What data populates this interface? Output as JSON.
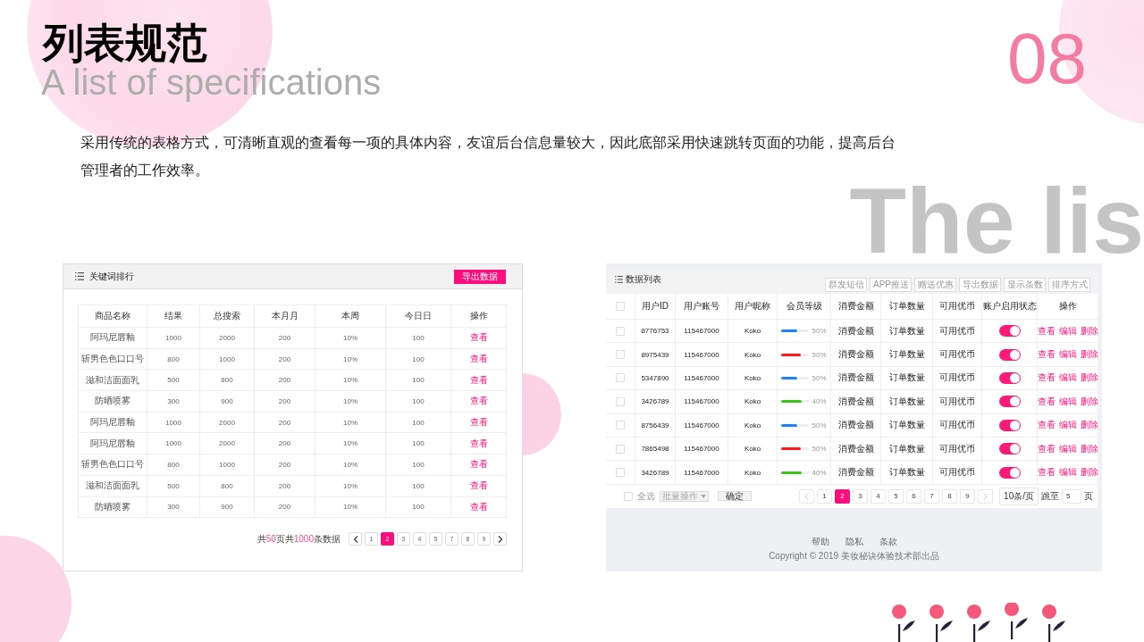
{
  "slide": {
    "title": "列表规范",
    "subtitle": "A list of specifications",
    "number": "08",
    "description": "采用传统的表格方式，可清晰直观的查看每一项的具体内容，友谊后台信息量较大，因此底部采用快速跳转页面的功能，提高后台管理者的工作效率。",
    "backdrop_text": "The lis"
  },
  "keyword_panel": {
    "title": "关键词排行",
    "export_button": "导出数据",
    "columns": [
      "商品名称",
      "结果",
      "总搜索",
      "本月月",
      "本周",
      "今日日",
      "操作"
    ],
    "rows": [
      {
        "cells": [
          "阿玛尼唇釉",
          "1000",
          "2000",
          "200",
          "10%",
          "100"
        ],
        "action": "查看"
      },
      {
        "cells": [
          "斩男色色口口号",
          "800",
          "1000",
          "200",
          "10%",
          "100"
        ],
        "action": "查看"
      },
      {
        "cells": [
          "滋和洁面面乳",
          "500",
          "800",
          "200",
          "10%",
          "100"
        ],
        "action": "查看"
      },
      {
        "cells": [
          "防晒喷雾",
          "300",
          "900",
          "200",
          "10%",
          "100"
        ],
        "action": "查看"
      },
      {
        "cells": [
          "阿玛尼唇釉",
          "1000",
          "2000",
          "200",
          "10%",
          "100"
        ],
        "action": "查看"
      },
      {
        "cells": [
          "阿玛尼唇釉",
          "1000",
          "2000",
          "200",
          "10%",
          "100"
        ],
        "action": "查看"
      },
      {
        "cells": [
          "斩男色色口口号",
          "800",
          "1000",
          "200",
          "10%",
          "100"
        ],
        "action": "查看"
      },
      {
        "cells": [
          "滋和洁面面乳",
          "500",
          "800",
          "200",
          "10%",
          "100"
        ],
        "action": "查看"
      },
      {
        "cells": [
          "防晒喷雾",
          "300",
          "900",
          "200",
          "10%",
          "100"
        ],
        "action": "查看"
      }
    ],
    "summary": [
      {
        "text": "共",
        "highlight": false
      },
      {
        "text": "50",
        "highlight": true
      },
      {
        "text": "页共",
        "highlight": false
      },
      {
        "text": "1000",
        "highlight": true
      },
      {
        "text": "条数据",
        "highlight": false
      }
    ],
    "pages": [
      {
        "label": "1",
        "selected": false
      },
      {
        "label": "2",
        "selected": true
      },
      {
        "label": "3",
        "selected": false
      },
      {
        "label": "4",
        "selected": false
      },
      {
        "label": "5",
        "selected": false
      },
      {
        "label": "7",
        "selected": false
      },
      {
        "label": "8",
        "selected": false
      },
      {
        "label": "9",
        "selected": false
      }
    ]
  },
  "user_panel": {
    "title": "数据列表",
    "dropdowns": [
      "群发短信",
      "APP推送",
      "赠送优惠",
      "导出数据",
      "显示条数",
      "排序方式"
    ],
    "header_checkbox": {
      "checked": false
    },
    "columns": [
      "用户ID",
      "用户账号",
      "用户昵称",
      "会员等级",
      "消费金额",
      "订单数量",
      "可用优币",
      "账户启用状态",
      "操作"
    ],
    "rows": [
      {
        "checked": false,
        "id": "8776753",
        "account": "115467000",
        "nickname": "Koko",
        "level": 0.55,
        "color": "#1a82ff",
        "percent": "50%",
        "amount": "消费金额",
        "orders": "订单数量",
        "coins": "可用优币",
        "on": true,
        "actions": [
          "查看",
          "编辑",
          "删除"
        ]
      },
      {
        "checked": false,
        "id": "8975439",
        "account": "115467000",
        "nickname": "Koko",
        "level": 0.68,
        "color": "#ff1a1a",
        "percent": "50%",
        "amount": "消费金额",
        "orders": "订单数量",
        "coins": "可用优币",
        "on": true,
        "actions": [
          "查看",
          "编辑",
          "删除"
        ]
      },
      {
        "checked": false,
        "id": "5347890",
        "account": "115467000",
        "nickname": "Koko",
        "level": 0.55,
        "color": "#1a82ff",
        "percent": "50%",
        "amount": "消费金额",
        "orders": "订单数量",
        "coins": "可用优币",
        "on": true,
        "actions": [
          "查看",
          "编辑",
          "删除"
        ]
      },
      {
        "checked": false,
        "id": "3426789",
        "account": "115467000",
        "nickname": "Koko",
        "level": 0.72,
        "color": "#3cc21a",
        "percent": "40%",
        "amount": "消费金额",
        "orders": "订单数量",
        "coins": "可用优币",
        "on": true,
        "actions": [
          "查看",
          "编辑",
          "删除"
        ]
      },
      {
        "checked": false,
        "id": "8756439",
        "account": "115467000",
        "nickname": "Koko",
        "level": 0.55,
        "color": "#1a82ff",
        "percent": "50%",
        "amount": "消费金额",
        "orders": "订单数量",
        "coins": "可用优币",
        "on": true,
        "actions": [
          "查看",
          "编辑",
          "删除"
        ]
      },
      {
        "checked": false,
        "id": "7865498",
        "account": "115467000",
        "nickname": "Koko",
        "level": 0.68,
        "color": "#ff1a1a",
        "percent": "50%",
        "amount": "消费金额",
        "orders": "订单数量",
        "coins": "可用优币",
        "on": true,
        "actions": [
          "查看",
          "编辑",
          "删除"
        ]
      },
      {
        "checked": false,
        "id": "3426789",
        "account": "115467000",
        "nickname": "Koko",
        "level": 0.72,
        "color": "#3cc21a",
        "percent": "40%",
        "amount": "消费金额",
        "orders": "订单数量",
        "coins": "可用优币",
        "on": true,
        "actions": [
          "查看",
          "编辑",
          "删除"
        ]
      }
    ],
    "footer": {
      "select_all": {
        "label": "全选",
        "checked": false
      },
      "batch_select": "批量操作",
      "confirm_button": "确定",
      "pages": [
        {
          "label": "1",
          "selected": false
        },
        {
          "label": "2",
          "selected": true
        },
        {
          "label": "3",
          "selected": false
        },
        {
          "label": "4",
          "selected": false
        },
        {
          "label": "5",
          "selected": false
        },
        {
          "label": "6",
          "selected": false
        },
        {
          "label": "7",
          "selected": false
        },
        {
          "label": "8",
          "selected": false
        },
        {
          "label": "9",
          "selected": false
        }
      ],
      "page_size": "10条/页",
      "jump_label": "跳至",
      "jump_value": "5",
      "page_suffix": "页"
    },
    "links": [
      "帮助",
      "隐私",
      "条款"
    ],
    "copyright": "Copyright © 2019 美妆秘诀体验技术部出品"
  }
}
